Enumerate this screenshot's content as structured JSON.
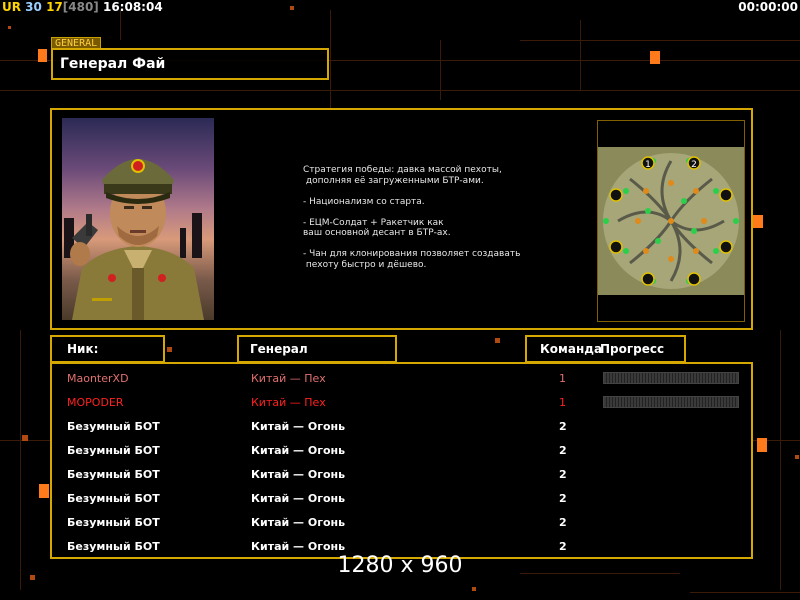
{
  "hud": {
    "ur": "UR",
    "fps": "30",
    "num": "17",
    "frame": "[480]",
    "time": "16:08:04",
    "timer": "00:00:00"
  },
  "general": {
    "tag": "GENERAL",
    "name": "Генерал Фай",
    "description": "Стратегия победы: давка массой пехоты,\n дополняя её загруженными БТР-ами.\n\n- Национализм со старта.\n\n- ЕЦМ-Солдат + Ракетчик как\nваш основной десант в БТР-ах.\n\n- Чан для клонирования позволяет создавать\n пехоту быстро и дёшево."
  },
  "map": {
    "start_labels": [
      "1",
      "2"
    ]
  },
  "columns": {
    "nick": "Ник:",
    "general": "Генерал",
    "team": "Команда",
    "progress": "Прогресс"
  },
  "players": [
    {
      "nick": "MaonterXD",
      "general": "Китай — Пех",
      "team": "1",
      "color": "#e07070",
      "progress": true
    },
    {
      "nick": "MOPODER",
      "general": "Китай — Пех",
      "team": "1",
      "color": "#ff2020",
      "progress": true
    },
    {
      "nick": "Безумный БОТ",
      "general": "Китай — Огонь",
      "team": "2",
      "color": "#ffffff",
      "progress": false
    },
    {
      "nick": "Безумный БОТ",
      "general": "Китай — Огонь",
      "team": "2",
      "color": "#ffffff",
      "progress": false
    },
    {
      "nick": "Безумный БОТ",
      "general": "Китай — Огонь",
      "team": "2",
      "color": "#ffffff",
      "progress": false
    },
    {
      "nick": "Безумный БОТ",
      "general": "Китай — Огонь",
      "team": "2",
      "color": "#ffffff",
      "progress": false
    },
    {
      "nick": "Безумный БОТ",
      "general": "Китай — Огонь",
      "team": "2",
      "color": "#ffffff",
      "progress": false
    },
    {
      "nick": "Безумный БОТ",
      "general": "Китай — Огонь",
      "team": "2",
      "color": "#ffffff",
      "progress": false
    }
  ],
  "resolution": "1280 x 960",
  "colors": {
    "accent": "#d4a800",
    "orange": "#ff7a1a"
  }
}
